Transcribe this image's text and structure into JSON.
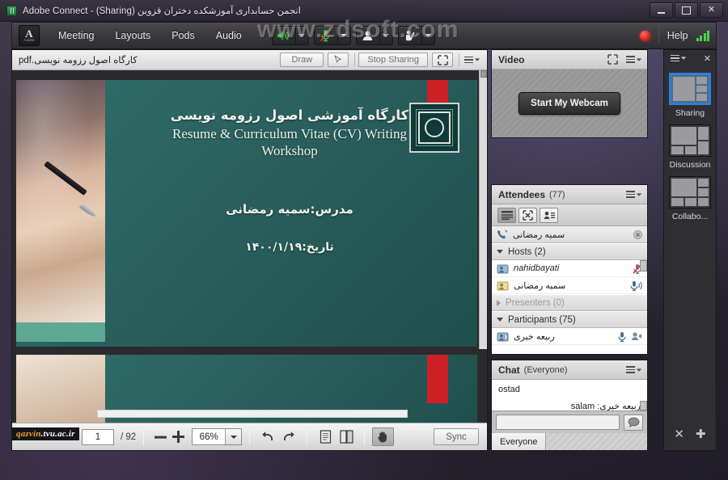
{
  "window": {
    "title": "انجمن حسابداری آموزشکده دختران قزوین (Sharing) - Adobe Connect",
    "app_icon": "excel-icon",
    "minimize": "minimize-icon",
    "maximize": "maximize-icon",
    "close": "close-icon"
  },
  "menubar": {
    "logo_letter": "A",
    "logo_word": "Adobe",
    "items": [
      {
        "label": "Meeting"
      },
      {
        "label": "Layouts"
      },
      {
        "label": "Pods"
      },
      {
        "label": "Audio"
      }
    ],
    "tools": [
      {
        "name": "speaker-icon",
        "state": "on"
      },
      {
        "name": "microphone-muted-icon",
        "state": "muted"
      },
      {
        "name": "webcam-icon",
        "state": "off"
      },
      {
        "name": "raise-hand-icon",
        "state": "off"
      }
    ],
    "recording_indicator": "record-dot",
    "help_label": "Help",
    "connection_label": "connection-strength"
  },
  "watermark_top": "www.zdsoft.com",
  "watermark_bottom": {
    "part1": "qazvin",
    "part2": ".tvu.ac.ir"
  },
  "share_pod": {
    "document_name": "کارگاه اصول رزومه نویسی.pdf",
    "draw_label": "Draw",
    "pointer_icon": "pointer-icon",
    "stop_sharing_label": "Stop Sharing",
    "fullscreen_icon": "fullscreen-icon",
    "menu_icon": "pod-menu-icon",
    "slide": {
      "title_fa": "کارگاه آموزشی اصول رزومه نویسی",
      "title_en_line1": "Resume & Curriculum Vitae (CV) Writing",
      "title_en_line2": "Workshop",
      "instructor": "مدرس:سمیه  رمضانی",
      "date": "تاریخ:۱۴۰۰/۱/۱۹"
    },
    "controls": {
      "page_current": "1",
      "page_total": "/ 92",
      "zoom_out_icon": "minus-icon",
      "zoom_in_icon": "plus-icon",
      "zoom_value": "66%",
      "zoom_caret_icon": "chevron-down-icon",
      "undo_icon": "undo-icon",
      "redo_icon": "redo-icon",
      "page_single_icon": "page-single-icon",
      "page_double_icon": "page-double-icon",
      "hand_icon": "hand-tool-icon",
      "sync_label": "Sync"
    }
  },
  "video_pod": {
    "title": "Video",
    "fullscreen_icon": "fullscreen-icon",
    "menu_icon": "pod-menu-icon",
    "start_webcam_label": "Start My Webcam"
  },
  "attendees_pod": {
    "title": "Attendees",
    "count": "(77)",
    "menu_icon": "pod-menu-icon",
    "toolbar": [
      {
        "name": "list-view-icon",
        "active": true
      },
      {
        "name": "breakout-rooms-icon",
        "active": false
      },
      {
        "name": "attendee-card-icon",
        "active": false
      }
    ],
    "self": {
      "name": "سمیه رمضانی",
      "phone_icon": "phone-icon",
      "clear_icon": "clear-status-icon"
    },
    "groups": [
      {
        "label": "Hosts (2)",
        "expanded": true,
        "members": [
          {
            "name": "nahidbayati",
            "script": "latin",
            "status_icon": "mic-muted-icon"
          },
          {
            "name": "سمیه رمضانی",
            "script": "arabic",
            "status_icon": "mic-active-icon"
          }
        ]
      },
      {
        "label": "Presenters (0)",
        "expanded": false,
        "members": []
      },
      {
        "label": "Participants (75)",
        "expanded": true,
        "members": [
          {
            "name": "ربیعه خیری",
            "script": "arabic",
            "status_icon": "mic-icon",
            "status_icon2": "webcam-icon"
          }
        ]
      }
    ]
  },
  "chat_pod": {
    "title": "Chat",
    "scope": "(Everyone)",
    "menu_icon": "pod-menu-icon",
    "messages": [
      {
        "text": "ostad",
        "rtl": false
      },
      {
        "text": "ربیعه خیری: salam",
        "rtl": true
      }
    ],
    "input_value": "",
    "send_icon": "chat-bubble-icon",
    "tab_label": "Everyone"
  },
  "layout_bar": {
    "menu_icon": "pod-menu-icon",
    "close_icon": "close-icon",
    "layouts": [
      {
        "label": "Sharing",
        "selected": true
      },
      {
        "label": "Discussion",
        "selected": false
      },
      {
        "label": "Collabo...",
        "selected": false
      }
    ],
    "close_layouts_icon": "close-x-icon",
    "add_layout_icon": "plus-icon"
  },
  "colors": {
    "accent_blue": "#2e7fd4",
    "record_red": "#cf1a12",
    "mic_green": "#4ad14a",
    "slide_teal": "#2b6360",
    "slide_red": "#cf2027",
    "watermark_orange": "#f0a02a"
  }
}
